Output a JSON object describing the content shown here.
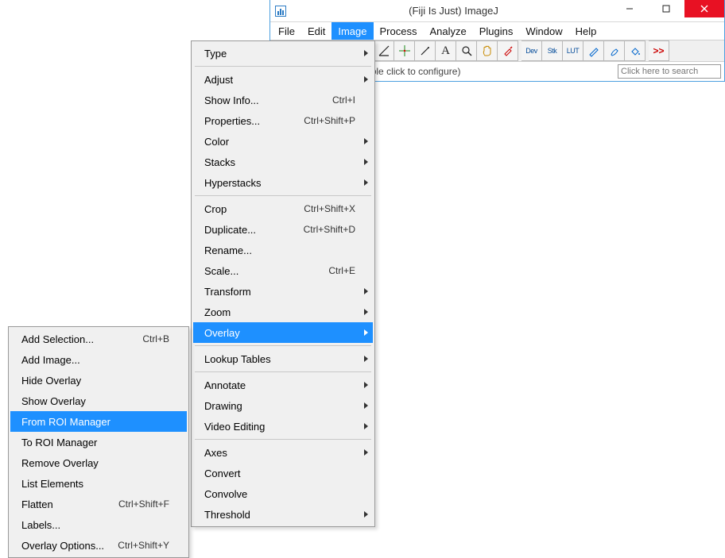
{
  "window": {
    "title": "(Fiji Is Just) ImageJ",
    "hint": "ight click to switch; double click to configure)",
    "search_placeholder": "Click here to search"
  },
  "menubar": [
    "File",
    "Edit",
    "Image",
    "Process",
    "Analyze",
    "Plugins",
    "Window",
    "Help"
  ],
  "toolbar_txt": {
    "dev": "Dev",
    "stk": "Stk",
    "lut": "LUT",
    "more": ">>"
  },
  "image_menu": [
    {
      "label": "Type",
      "sub": true
    },
    {
      "sep": true
    },
    {
      "label": "Adjust",
      "sub": true
    },
    {
      "label": "Show Info...",
      "accel": "Ctrl+I"
    },
    {
      "label": "Properties...",
      "accel": "Ctrl+Shift+P"
    },
    {
      "label": "Color",
      "sub": true
    },
    {
      "label": "Stacks",
      "sub": true
    },
    {
      "label": "Hyperstacks",
      "sub": true
    },
    {
      "sep": true
    },
    {
      "label": "Crop",
      "accel": "Ctrl+Shift+X"
    },
    {
      "label": "Duplicate...",
      "accel": "Ctrl+Shift+D"
    },
    {
      "label": "Rename..."
    },
    {
      "label": "Scale...",
      "accel": "Ctrl+E"
    },
    {
      "label": "Transform",
      "sub": true
    },
    {
      "label": "Zoom",
      "sub": true
    },
    {
      "label": "Overlay",
      "sub": true,
      "selected": true
    },
    {
      "sep": true
    },
    {
      "label": "Lookup Tables",
      "sub": true
    },
    {
      "sep": true
    },
    {
      "label": "Annotate",
      "sub": true
    },
    {
      "label": "Drawing",
      "sub": true
    },
    {
      "label": "Video Editing",
      "sub": true
    },
    {
      "sep": true
    },
    {
      "label": "Axes",
      "sub": true
    },
    {
      "label": "Convert"
    },
    {
      "label": "Convolve"
    },
    {
      "label": "Threshold",
      "sub": true
    }
  ],
  "overlay_menu": [
    {
      "label": "Add Selection...",
      "accel": "Ctrl+B"
    },
    {
      "label": "Add Image..."
    },
    {
      "label": "Hide Overlay"
    },
    {
      "label": "Show Overlay"
    },
    {
      "label": "From ROI Manager",
      "selected": true
    },
    {
      "label": "To ROI Manager"
    },
    {
      "label": "Remove Overlay"
    },
    {
      "label": "List Elements"
    },
    {
      "label": "Flatten",
      "accel": "Ctrl+Shift+F"
    },
    {
      "label": "Labels..."
    },
    {
      "label": "Overlay Options...",
      "accel": "Ctrl+Shift+Y"
    }
  ]
}
